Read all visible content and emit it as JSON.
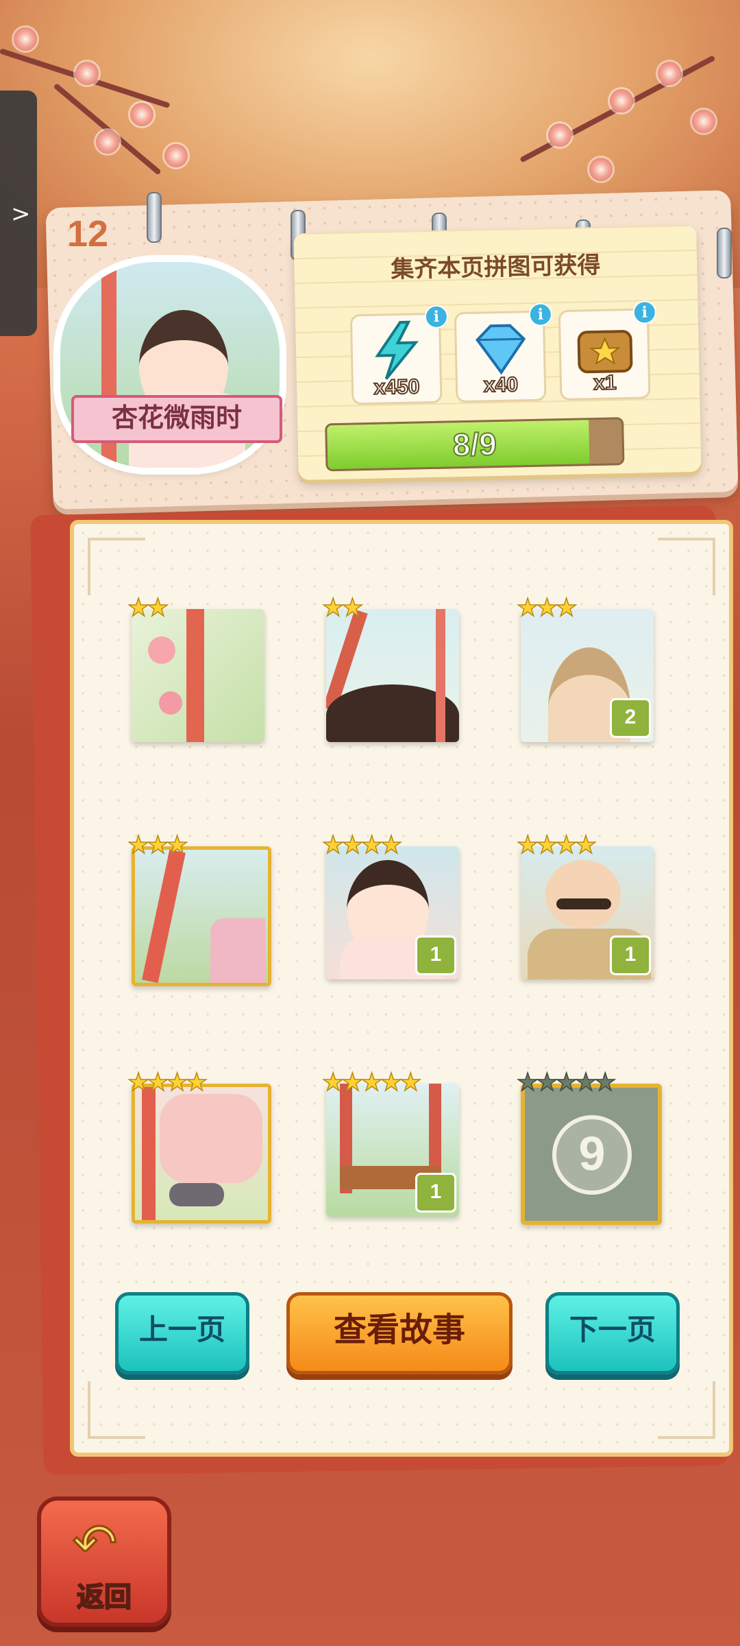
{
  "chapter": {
    "number": "12",
    "title": "杏花微雨时"
  },
  "rewards": {
    "title": "集齐本页拼图可获得",
    "items": [
      {
        "icon": "energy-bolt-icon",
        "qty": "x450"
      },
      {
        "icon": "diamond-icon",
        "qty": "x40"
      },
      {
        "icon": "treasure-chest-icon",
        "qty": "x1"
      }
    ],
    "info_symbol": "i",
    "progress_text": "8/9",
    "progress_value": 0.889
  },
  "pieces": [
    {
      "stars": "★★",
      "count": ""
    },
    {
      "stars": "★★",
      "count": ""
    },
    {
      "stars": "★★★",
      "count": "2"
    },
    {
      "stars": "★★★",
      "count": ""
    },
    {
      "stars": "★★★★",
      "count": "1"
    },
    {
      "stars": "★★★★",
      "count": "1"
    },
    {
      "stars": "★★★★",
      "count": ""
    },
    {
      "stars": "★★★★★",
      "count": "1"
    },
    {
      "stars": "★★★★★",
      "locked_number": "9"
    }
  ],
  "buttons": {
    "prev": "上一页",
    "story": "查看故事",
    "next": "下一页",
    "back": "返回"
  },
  "side_tab": {
    "arrow": ">"
  },
  "colors": {
    "accent_teal": "#1cc3bc",
    "accent_orange": "#f58a18",
    "star_gold": "#ffd233"
  }
}
